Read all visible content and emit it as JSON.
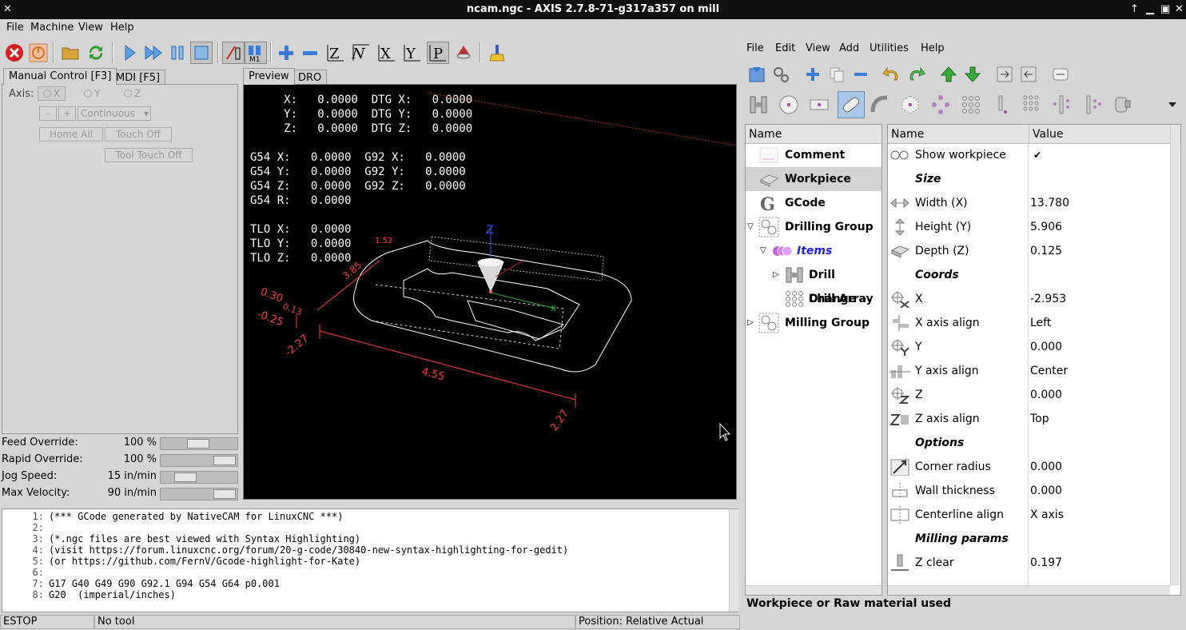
{
  "window": {
    "title": "ncam.ngc - AXIS 2.7.8-71-g317a357 on mill"
  },
  "menubar": [
    "File",
    "Machine",
    "View",
    "Help"
  ],
  "manual_tabs": [
    {
      "label": "Manual Control [F3]"
    },
    {
      "label": "MDI [F5]"
    }
  ],
  "manual": {
    "axis_label": "Axis:",
    "axes": [
      "X",
      "Y",
      "Z"
    ],
    "minus": "-",
    "plus": "+",
    "jog_mode": "Continuous",
    "home_all": "Home All",
    "touch_off": "Touch Off",
    "tool_touch_off": "Tool Touch Off"
  },
  "overrides": [
    {
      "label": "Feed Override:",
      "value": "100 %",
      "fraction": 0.5
    },
    {
      "label": "Rapid Override:",
      "value": "100 %",
      "fraction": 1.0
    },
    {
      "label": "Jog Speed:",
      "value": "15 in/min",
      "fraction": 0.25
    },
    {
      "label": "Max Velocity:",
      "value": "90 in/min",
      "fraction": 1.0
    }
  ],
  "preview_tabs": [
    {
      "label": "Preview"
    },
    {
      "label": "DRO"
    }
  ],
  "dro_lines": [
    "     X:   0.0000  DTG X:   0.0000",
    "     Y:   0.0000  DTG Y:   0.0000",
    "     Z:   0.0000  DTG Z:   0.0000",
    "",
    "G54 X:   0.0000  G92 X:   0.0000",
    "G54 Y:   0.0000  G92 Y:   0.0000",
    "G54 Z:   0.0000  G92 Z:   0.0000",
    "G54 R:   0.0000",
    "",
    "TLO X:   0.0000",
    "TLO Y:   0.0000",
    "TLO Z:   0.0000"
  ],
  "preview_labels": {
    "z_axis": "Z",
    "dim_top": "1.52",
    "dim_left": "3.85",
    "dim_z1": "0.30",
    "dim_z2": "0.13",
    "dim_z3": "-0.25",
    "dim_x_start": "-2.27",
    "dim_x_len": "4.55",
    "dim_x_end": "2.27",
    "x_marker": "x"
  },
  "gcode_lines": [
    {
      "n": "1:",
      "text": "(*** GCode generated by NativeCAM for LinuxCNC ***)"
    },
    {
      "n": "2:",
      "text": ""
    },
    {
      "n": "3:",
      "text": "(*.ngc files are best viewed with Syntax Highlighting)"
    },
    {
      "n": "4:",
      "text": "(visit https://forum.linuxcnc.org/forum/20-g-code/30840-new-syntax-highlighting-for-gedit)"
    },
    {
      "n": "5:",
      "text": "(or https://github.com/FernV/Gcode-highlight-for-Kate)"
    },
    {
      "n": "6:",
      "text": ""
    },
    {
      "n": "7:",
      "text": "G17 G40 G49 G90 G92.1 G94 G54 G64 p0.001"
    },
    {
      "n": "8:",
      "text": "G20  (imperial/inches)"
    }
  ],
  "status": {
    "estop": "ESTOP",
    "tool": "No tool",
    "position": "Position: Relative Actual"
  },
  "right_menubar": [
    "File",
    "Edit",
    "View",
    "Add",
    "Utilities",
    "Help"
  ],
  "tree": {
    "header": "Name",
    "items": [
      {
        "label": "Comment"
      },
      {
        "label": "Workpiece"
      },
      {
        "label": "GCode"
      },
      {
        "label": "Drilling Group"
      },
      {
        "label": "Items"
      },
      {
        "label": "Drill Change"
      },
      {
        "label": "Drill Array"
      },
      {
        "label": "Milling Group"
      }
    ]
  },
  "props": {
    "name_header": "Name",
    "value_header": "Value",
    "rows": [
      {
        "name": "Show workpiece",
        "value": "✔"
      },
      {
        "name": "Size",
        "value": ""
      },
      {
        "name": "Width (X)",
        "value": "13.780"
      },
      {
        "name": "Height (Y)",
        "value": "5.906"
      },
      {
        "name": "Depth (Z)",
        "value": "0.125"
      },
      {
        "name": "Coords",
        "value": ""
      },
      {
        "name": "X",
        "value": "-2.953"
      },
      {
        "name": "X axis align",
        "value": "Left"
      },
      {
        "name": "Y",
        "value": "0.000"
      },
      {
        "name": "Y axis align",
        "value": "Center"
      },
      {
        "name": "Z",
        "value": "0.000"
      },
      {
        "name": "Z axis align",
        "value": "Top"
      },
      {
        "name": "Options",
        "value": ""
      },
      {
        "name": "Corner radius",
        "value": "0.000"
      },
      {
        "name": "Wall thickness",
        "value": "0.000"
      },
      {
        "name": "Centerline align",
        "value": "X axis"
      },
      {
        "name": "Milling params",
        "value": ""
      },
      {
        "name": "Z clear",
        "value": "0.197"
      }
    ]
  },
  "right_status": "Workpiece or Raw material used",
  "colors": {
    "estop_red": "#d52020",
    "blue_icon": "#3a7bd5",
    "preview_bg": "#000000",
    "red_dim": "#ff3a3a",
    "green_arrow": "#22aa22"
  }
}
